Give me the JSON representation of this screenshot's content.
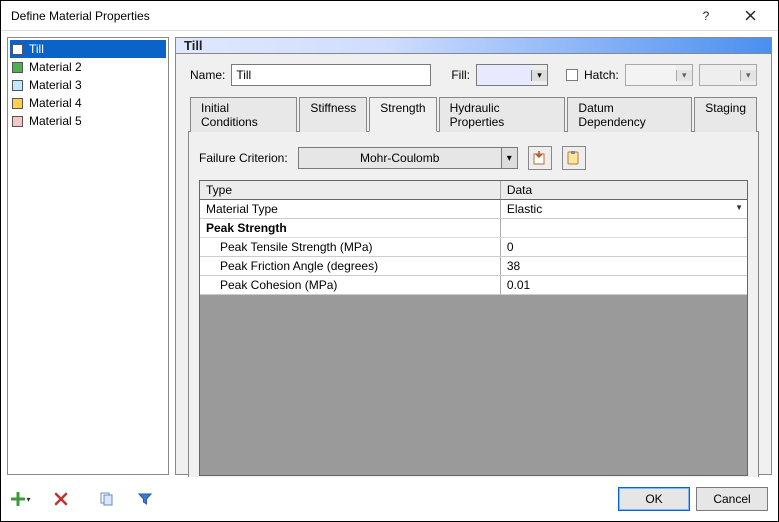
{
  "window": {
    "title": "Define Material Properties"
  },
  "materials": [
    {
      "name": "Till",
      "swatch": "#ffffff",
      "selected": true
    },
    {
      "name": "Material 2",
      "swatch": "#4caf50",
      "selected": false
    },
    {
      "name": "Material 3",
      "swatch": "#bfe8ff",
      "selected": false
    },
    {
      "name": "Material 4",
      "swatch": "#ffcf4d",
      "selected": false
    },
    {
      "name": "Material 5",
      "swatch": "#f7c6c6",
      "selected": false
    }
  ],
  "header": {
    "current_material": "Till"
  },
  "form": {
    "name_label": "Name:",
    "name_value": "Till",
    "fill_label": "Fill:",
    "fill_swatch": "#e8e8ff",
    "hatch_label": "Hatch:",
    "hatch_checked": false
  },
  "tabs": [
    {
      "label": "Initial Conditions",
      "active": false
    },
    {
      "label": "Stiffness",
      "active": false
    },
    {
      "label": "Strength",
      "active": true
    },
    {
      "label": "Hydraulic Properties",
      "active": false
    },
    {
      "label": "Datum Dependency",
      "active": false
    },
    {
      "label": "Staging",
      "active": false
    }
  ],
  "strength": {
    "criterion_label": "Failure Criterion:",
    "criterion_value": "Mohr-Coulomb",
    "icon1": "import-icon",
    "icon2": "paste-icon",
    "columns": {
      "type": "Type",
      "data": "Data"
    },
    "rows": [
      {
        "kind": "data",
        "type": "Material Type",
        "data": "Elastic",
        "has_dropdown": true
      },
      {
        "kind": "group",
        "type": "Peak Strength",
        "data": ""
      },
      {
        "kind": "sub",
        "type": "Peak Tensile Strength (MPa)",
        "data": "0"
      },
      {
        "kind": "sub",
        "type": "Peak Friction Angle (degrees)",
        "data": "38"
      },
      {
        "kind": "sub",
        "type": "Peak Cohesion (MPa)",
        "data": "0.01"
      }
    ]
  },
  "footer": {
    "add": "add-icon",
    "delete": "delete-icon",
    "copy": "copy-icon",
    "filter": "filter-icon",
    "ok": "OK",
    "cancel": "Cancel"
  }
}
